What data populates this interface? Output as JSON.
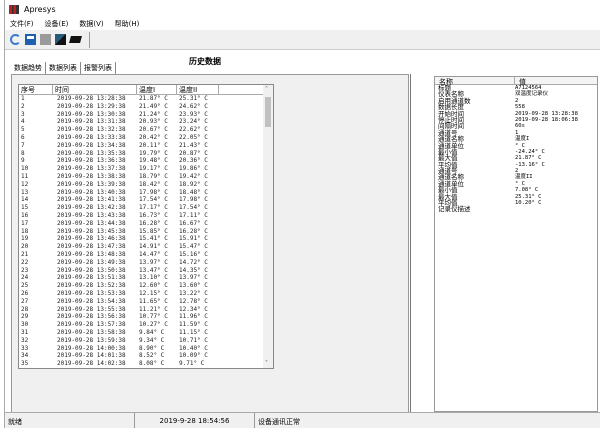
{
  "window": {
    "title": "Apresys"
  },
  "menu": [
    "文件(F)",
    "设备(E)",
    "数据(V)",
    "帮助(H)"
  ],
  "toolbar": {
    "icons": [
      "refresh-icon",
      "save-icon",
      "stop-icon",
      "print-icon",
      "folder-icon"
    ]
  },
  "page": {
    "title": "历史数据",
    "tabs": [
      "数据趋势",
      "数据列表",
      "报警列表"
    ],
    "active_tab": 1
  },
  "table": {
    "headers": [
      "序号",
      "时间",
      "温度I",
      "温度II"
    ],
    "rows": [
      [
        "1",
        "2019-09-28 13:28:38",
        "21.87° C",
        "25.31° C"
      ],
      [
        "2",
        "2019-09-28 13:29:38",
        "21.49° C",
        "24.62° C"
      ],
      [
        "3",
        "2019-09-28 13:30:38",
        "21.24° C",
        "23.93° C"
      ],
      [
        "4",
        "2019-09-28 13:31:38",
        "20.93° C",
        "23.24° C"
      ],
      [
        "5",
        "2019-09-28 13:32:38",
        "20.67° C",
        "22.62° C"
      ],
      [
        "6",
        "2019-09-28 13:33:38",
        "20.42° C",
        "22.05° C"
      ],
      [
        "7",
        "2019-09-28 13:34:38",
        "20.11° C",
        "21.43° C"
      ],
      [
        "8",
        "2019-09-28 13:35:38",
        "19.79° C",
        "20.87° C"
      ],
      [
        "9",
        "2019-09-28 13:36:38",
        "19.48° C",
        "20.36° C"
      ],
      [
        "10",
        "2019-09-28 13:37:38",
        "19.17° C",
        "19.86° C"
      ],
      [
        "11",
        "2019-09-28 13:38:38",
        "18.79° C",
        "19.42° C"
      ],
      [
        "12",
        "2019-09-28 13:39:38",
        "18.42° C",
        "18.92° C"
      ],
      [
        "13",
        "2019-09-28 13:40:38",
        "17.98° C",
        "18.48° C"
      ],
      [
        "14",
        "2019-09-28 13:41:38",
        "17.54° C",
        "17.98° C"
      ],
      [
        "15",
        "2019-09-28 13:42:38",
        "17.17° C",
        "17.54° C"
      ],
      [
        "16",
        "2019-09-28 13:43:38",
        "16.73° C",
        "17.11° C"
      ],
      [
        "17",
        "2019-09-28 13:44:38",
        "16.28° C",
        "16.67° C"
      ],
      [
        "18",
        "2019-09-28 13:45:38",
        "15.85° C",
        "16.28° C"
      ],
      [
        "19",
        "2019-09-28 13:46:38",
        "15.41° C",
        "15.91° C"
      ],
      [
        "20",
        "2019-09-28 13:47:38",
        "14.91° C",
        "15.47° C"
      ],
      [
        "21",
        "2019-09-28 13:48:38",
        "14.47° C",
        "15.16° C"
      ],
      [
        "22",
        "2019-09-28 13:49:38",
        "13.97° C",
        "14.72° C"
      ],
      [
        "23",
        "2019-09-28 13:50:38",
        "13.47° C",
        "14.35° C"
      ],
      [
        "24",
        "2019-09-28 13:51:38",
        "13.10° C",
        "13.97° C"
      ],
      [
        "25",
        "2019-09-28 13:52:38",
        "12.60° C",
        "13.60° C"
      ],
      [
        "26",
        "2019-09-28 13:53:38",
        "12.15° C",
        "13.22° C"
      ],
      [
        "27",
        "2019-09-28 13:54:38",
        "11.65° C",
        "12.78° C"
      ],
      [
        "28",
        "2019-09-28 13:55:38",
        "11.21° C",
        "12.34° C"
      ],
      [
        "29",
        "2019-09-28 13:56:38",
        "10.77° C",
        "11.96° C"
      ],
      [
        "30",
        "2019-09-28 13:57:38",
        "10.27° C",
        "11.59° C"
      ],
      [
        "31",
        "2019-09-28 13:58:38",
        "9.84° C",
        "11.15° C"
      ],
      [
        "32",
        "2019-09-28 13:59:38",
        "9.34° C",
        "10.71° C"
      ],
      [
        "33",
        "2019-09-28 14:00:38",
        "8.90° C",
        "10.40° C"
      ],
      [
        "34",
        "2019-09-28 14:01:38",
        "8.52° C",
        "10.09° C"
      ],
      [
        "35",
        "2019-09-28 14:02:38",
        "8.08° C",
        "9.71° C"
      ]
    ]
  },
  "props": {
    "headers": [
      "名称",
      "值"
    ],
    "rows": [
      [
        "标题",
        "A7124564"
      ],
      [
        "仪表名称",
        "双温度记录仪"
      ],
      [
        "启用通道数",
        "2"
      ],
      [
        "数据长度",
        "558"
      ],
      [
        "开始时间",
        "2019-09-28 13:28:38"
      ],
      [
        "停止时间",
        "2019-09-28 18:06:38"
      ],
      [
        "间隔时间",
        "60s"
      ],
      [
        "通道号",
        "1"
      ],
      [
        "通道名称",
        "温度I"
      ],
      [
        "通道单位",
        "° C"
      ],
      [
        "最小值",
        "-24.24° C"
      ],
      [
        "最大值",
        "21.87° C"
      ],
      [
        "平均值",
        "-13.16° C"
      ],
      [
        "通道号",
        "2"
      ],
      [
        "通道名称",
        "温度II"
      ],
      [
        "通道单位",
        "° C"
      ],
      [
        "最小值",
        "7.08° C"
      ],
      [
        "最大值",
        "25.31° C"
      ],
      [
        "平均值",
        "10.20° C"
      ],
      [
        "记录仪描述",
        ""
      ]
    ]
  },
  "status": {
    "state": "就绪",
    "time": "2019-9-28 18:54:56",
    "comm": "设备通讯正常"
  }
}
